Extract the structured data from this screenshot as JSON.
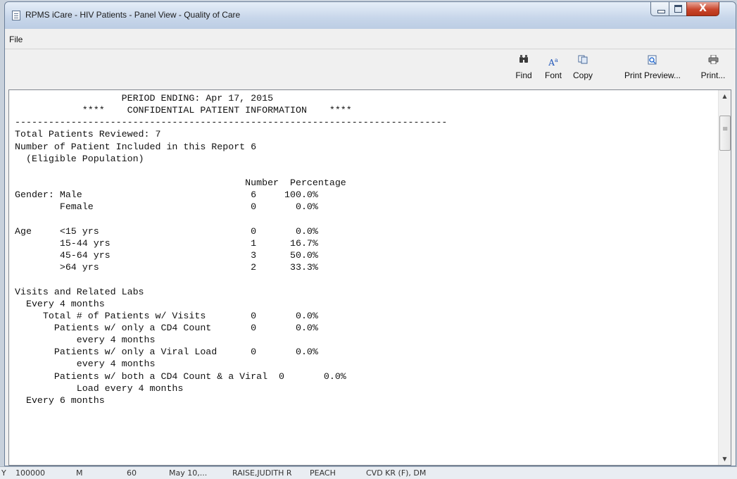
{
  "window": {
    "title": "RPMS iCare - HIV Patients - Panel View - Quality of Care",
    "close_symbol": "X"
  },
  "menu": {
    "file": "File"
  },
  "toolbar": {
    "find": "Find",
    "font": "Font",
    "copy": "Copy",
    "print_preview": "Print Preview...",
    "print": "Print..."
  },
  "report": {
    "lines": [
      "                   PERIOD ENDING: Apr 17, 2015",
      "            ****    CONFIDENTIAL PATIENT INFORMATION    ****",
      "-----------------------------------------------------------------------------",
      "Total Patients Reviewed: 7",
      "Number of Patient Included in this Report 6",
      "  (Eligible Population)",
      "",
      "                                         Number  Percentage",
      "Gender: Male                              6     100.0%",
      "        Female                            0       0.0%",
      "",
      "Age     <15 yrs                           0       0.0%",
      "        15-44 yrs                         1      16.7%",
      "        45-64 yrs                         3      50.0%",
      "        >64 yrs                           2      33.3%",
      "",
      "Visits and Related Labs",
      "  Every 4 months",
      "     Total # of Patients w/ Visits        0       0.0%",
      "       Patients w/ only a CD4 Count       0       0.0%",
      "           every 4 months",
      "       Patients w/ only a Viral Load      0       0.0%",
      "           every 4 months",
      "       Patients w/ both a CD4 Count & a Viral  0       0.0%",
      "           Load every 4 months",
      "  Every 6 months"
    ]
  },
  "background_app": {
    "row_fragments": [
      "Y",
      "100000",
      "M",
      "60",
      "May 10,...",
      "RAISE,JUDITH R",
      "PEACH",
      "CVD KR (F), DM"
    ]
  },
  "colors": {
    "titlebar": "#c7d6ea",
    "close_button": "#c9462c",
    "report_background": "#ffffff"
  },
  "icons": {
    "find": "binoculars-icon",
    "font": "font-icon",
    "copy": "copy-icon",
    "print_preview": "print-preview-icon",
    "print": "printer-icon"
  }
}
